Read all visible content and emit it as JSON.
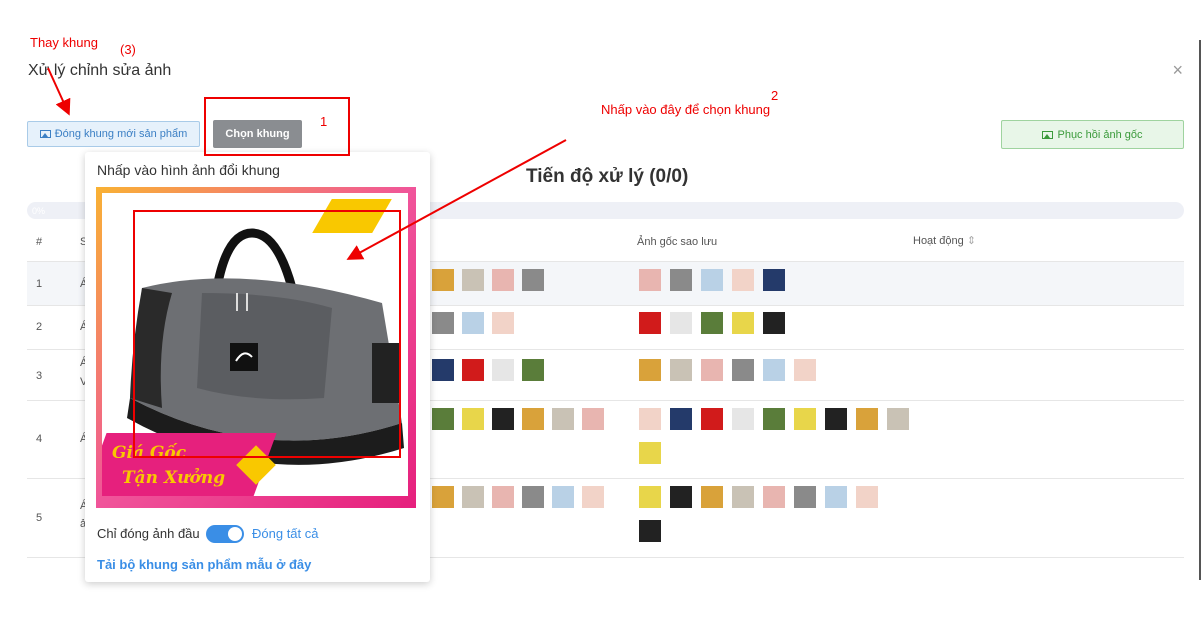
{
  "annotations": {
    "change_frame": "Thay khung",
    "step3": "(3)",
    "step1": "1",
    "step2": "2",
    "click_here": "Nhấp vào đây để chọn khung"
  },
  "modal": {
    "title": "Xử lý chỉnh sửa ảnh",
    "close": "×"
  },
  "toolbar": {
    "frame_button": "Đóng khung mới sản phẩm",
    "choose_button": "Chọn khung",
    "restore_button": "Phục hồi ảnh gốc"
  },
  "progress": {
    "title": "Tiến độ xử lý (0/0)",
    "percent": "0%"
  },
  "table": {
    "headers": {
      "index": "#",
      "name_partial": "S",
      "backup": "Ảnh gốc sao lưu",
      "action": "Hoạt động"
    },
    "rows": [
      {
        "index": "1",
        "text": "Á",
        "text2": ""
      },
      {
        "index": "2",
        "text": "Á",
        "text2": ""
      },
      {
        "index": "3",
        "text": "Á",
        "text2": "V"
      },
      {
        "index": "4",
        "text": "Á",
        "text2": ""
      },
      {
        "index": "5",
        "text": "Á",
        "text2": "ả"
      }
    ]
  },
  "popover": {
    "title": "Nhấp vào hình ảnh đổi khung",
    "frame_text_line1": "Giá Gốc",
    "frame_text_line2": "Tận Xưởng",
    "toggle_left": "Chỉ đóng ảnh đầu",
    "toggle_right": "Đóng tất cả",
    "toggle_state": true,
    "download_link": "Tải bộ khung sản phẩm mẫu ở đây"
  },
  "colors": {
    "accent": "#3a8ee6",
    "annotation": "#ee0000",
    "frame_pink": "#e6207d",
    "frame_yellow": "#f9c800"
  }
}
